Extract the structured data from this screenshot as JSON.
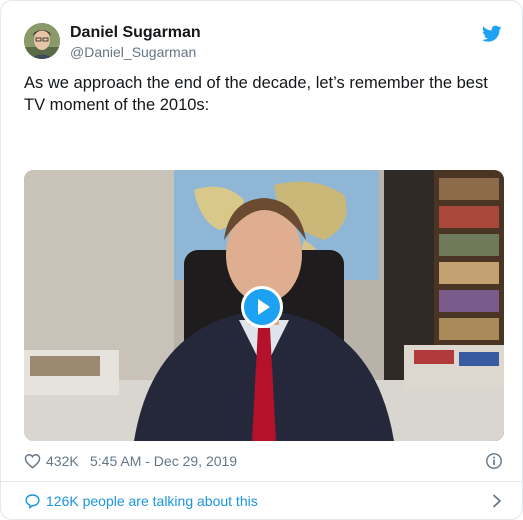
{
  "tweet": {
    "author_name": "Daniel Sugarman",
    "author_handle": "@Daniel_Sugarman",
    "text": "As we approach the end of the decade, let’s remember the best TV moment of the 2010s:",
    "likes": "432K",
    "timestamp": "5:45 AM - Dec 29, 2019",
    "conversation": "126K people are talking about this"
  },
  "icons": {
    "brand": "twitter-bird-icon",
    "like": "heart-icon",
    "info": "info-icon",
    "reply": "speech-bubble-icon",
    "more": "chevron-right-icon",
    "video": "play-icon"
  },
  "colors": {
    "accent": "#1da1f2",
    "link": "#1b95e0",
    "text": "#14171a",
    "muted": "#657786",
    "border": "#e1e8ed"
  }
}
